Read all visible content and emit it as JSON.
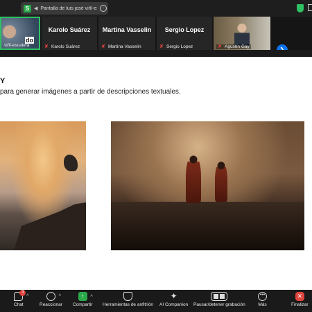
{
  "topbar": {
    "share_icon_letter": "S",
    "share_text": "Pantalla de luis josé viñl-esc",
    "share_more": "…"
  },
  "participants": [
    {
      "name": "",
      "label": "viñl-escalera",
      "tag": "do",
      "muted": false
    },
    {
      "name": "Karolo Suárez",
      "label": "Karolo Suárez",
      "muted": true
    },
    {
      "name": "Martina Vasselin",
      "label": "Martina Vasselin",
      "muted": true
    },
    {
      "name": "Sergio Lopez",
      "label": "Sergio Lopez",
      "muted": true
    },
    {
      "name": "",
      "label": "Agustín Gay",
      "muted": true
    }
  ],
  "slide": {
    "title": "Y",
    "subtitle": "para generar imágenes a partir de descripciones textuales."
  },
  "toolbar": {
    "chat": "Chat",
    "chat_badge": "3",
    "react": "Reaccionar",
    "share": "Compartir",
    "host_tools": "Herramientas de anfitrión",
    "ai": "AI Companion",
    "record": "Pausar/detener grabación",
    "more": "Más",
    "end": "Finalizar"
  },
  "colors": {
    "accent": "#2ec163",
    "share": "#2aa84a",
    "end": "#e0443c",
    "nav": "#0e72ed"
  }
}
